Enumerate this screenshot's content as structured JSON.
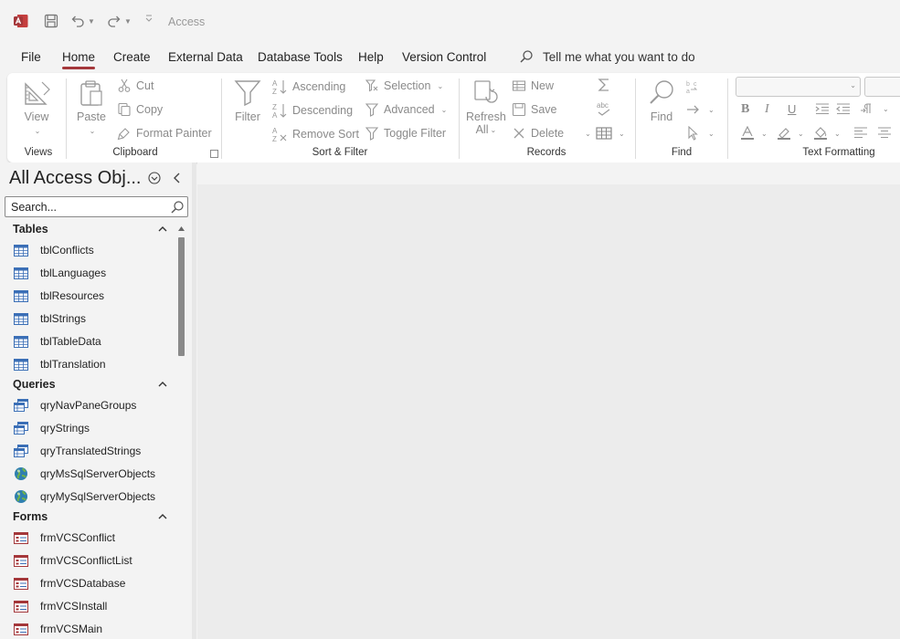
{
  "app": {
    "title": "Access"
  },
  "tabs": [
    {
      "label": "File"
    },
    {
      "label": "Home",
      "active": true
    },
    {
      "label": "Create"
    },
    {
      "label": "External Data"
    },
    {
      "label": "Database Tools"
    },
    {
      "label": "Help"
    },
    {
      "label": "Version Control"
    }
  ],
  "tell_me": {
    "text": "Tell me what you want to do"
  },
  "ribbon": {
    "views": {
      "label": "Views",
      "view_button": "View"
    },
    "clipboard": {
      "label": "Clipboard",
      "paste": "Paste",
      "cut": "Cut",
      "copy": "Copy",
      "format_painter": "Format Painter"
    },
    "sort_filter": {
      "label": "Sort & Filter",
      "filter": "Filter",
      "ascending": "Ascending",
      "descending": "Descending",
      "remove_sort": "Remove Sort",
      "selection": "Selection",
      "advanced": "Advanced",
      "toggle_filter": "Toggle Filter"
    },
    "records": {
      "label": "Records",
      "refresh": "Refresh",
      "refresh_all": "All",
      "new": "New",
      "save": "Save",
      "delete": "Delete"
    },
    "find": {
      "label": "Find",
      "find": "Find"
    },
    "text_formatting": {
      "label": "Text Formatting",
      "bold": "B",
      "italic": "I",
      "underline": "U"
    }
  },
  "nav_pane": {
    "title": "All Access Obj...",
    "search_placeholder": "Search...",
    "sections": {
      "tables": {
        "label": "Tables",
        "items": [
          "tblConflicts",
          "tblLanguages",
          "tblResources",
          "tblStrings",
          "tblTableData",
          "tblTranslation"
        ]
      },
      "queries": {
        "label": "Queries",
        "items": [
          "qryNavPaneGroups",
          "qryStrings",
          "qryTranslatedStrings",
          "qryMsSqlServerObjects",
          "qryMySqlServerObjects"
        ]
      },
      "forms": {
        "label": "Forms",
        "items": [
          "frmVCSConflict",
          "frmVCSConflictList",
          "frmVCSDatabase",
          "frmVCSInstall",
          "frmVCSMain"
        ]
      }
    }
  },
  "colors": {
    "accent": "#a4373a",
    "disabled_text": "#8a8a8a",
    "table_icon": "#3b6fb6",
    "form_icon": "#a4373a"
  }
}
